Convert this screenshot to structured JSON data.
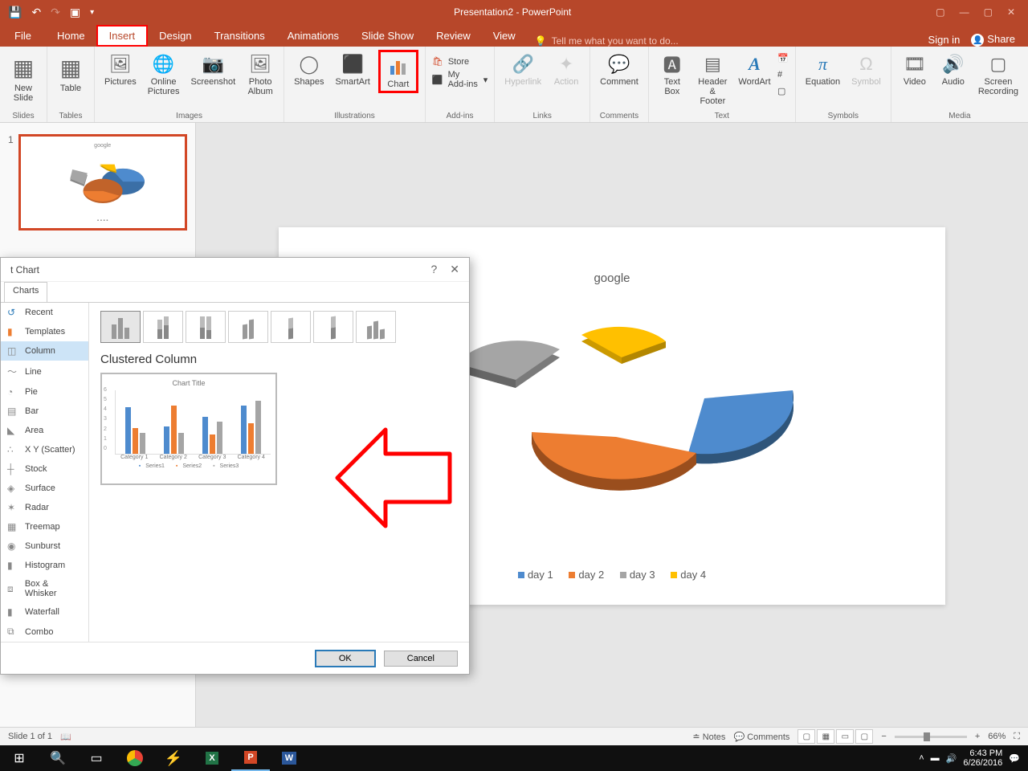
{
  "app": {
    "title": "Presentation2 - PowerPoint"
  },
  "menu": {
    "tabs": [
      "File",
      "Home",
      "Insert",
      "Design",
      "Transitions",
      "Animations",
      "Slide Show",
      "Review",
      "View"
    ],
    "active": "Insert",
    "tellme": "Tell me what you want to do...",
    "signin": "Sign in",
    "share": "Share"
  },
  "ribbon": {
    "groups": {
      "slides": {
        "label": "Slides",
        "new_slide": "New\nSlide"
      },
      "tables": {
        "label": "Tables",
        "table": "Table"
      },
      "images": {
        "label": "Images",
        "pictures": "Pictures",
        "online_pictures": "Online\nPictures",
        "screenshot": "Screenshot",
        "photo_album": "Photo\nAlbum"
      },
      "illustrations": {
        "label": "Illustrations",
        "shapes": "Shapes",
        "smartart": "SmartArt",
        "chart": "Chart"
      },
      "addins": {
        "label": "Add-ins",
        "store": "Store",
        "myaddins": "My Add-ins"
      },
      "links": {
        "label": "Links",
        "hyperlink": "Hyperlink",
        "action": "Action"
      },
      "comments": {
        "label": "Comments",
        "comment": "Comment"
      },
      "text": {
        "label": "Text",
        "textbox": "Text\nBox",
        "headerfooter": "Header\n& Footer",
        "wordart": "WordArt"
      },
      "symbols": {
        "label": "Symbols",
        "equation": "Equation",
        "symbol": "Symbol"
      },
      "media": {
        "label": "Media",
        "video": "Video",
        "audio": "Audio",
        "screenrec": "Screen\nRecording"
      }
    }
  },
  "thumb": {
    "num": "1",
    "slide_title": "google"
  },
  "slide": {
    "title": "google",
    "legend": {
      "items": [
        "day 1",
        "day 2",
        "day 3",
        "day 4"
      ],
      "colors": [
        "#4e8bce",
        "#ed7d31",
        "#a5a5a5",
        "#ffc000"
      ]
    }
  },
  "dialog": {
    "title": "t Chart",
    "help": "?",
    "tab": "Charts",
    "types": [
      "Recent",
      "Templates",
      "Column",
      "Line",
      "Pie",
      "Bar",
      "Area",
      "X Y (Scatter)",
      "Stock",
      "Surface",
      "Radar",
      "Treemap",
      "Sunburst",
      "Histogram",
      "Box & Whisker",
      "Waterfall",
      "Combo"
    ],
    "selected_type": "Column",
    "subtype_name": "Clustered Column",
    "preview_title": "Chart Title",
    "preview_cats": [
      "Category 1",
      "Category 2",
      "Category 3",
      "Category 4"
    ],
    "preview_series": [
      "Series1",
      "Series2",
      "Series3"
    ],
    "ok": "OK",
    "cancel": "Cancel"
  },
  "status": {
    "slide": "Slide 1 of 1",
    "notes": "Notes",
    "comments": "Comments",
    "zoom": "66%"
  },
  "taskbar": {
    "time": "6:43 PM",
    "date": "6/26/2016"
  },
  "chart_data": {
    "type": "pie",
    "title": "google",
    "categories": [
      "day 1",
      "day 2",
      "day 3",
      "day 4"
    ],
    "values": [
      35,
      30,
      20,
      15
    ],
    "colors": [
      "#4e8bce",
      "#ed7d31",
      "#a5a5a5",
      "#ffc000"
    ],
    "note": "3D exploded pie; values estimated by visual slice angle"
  }
}
